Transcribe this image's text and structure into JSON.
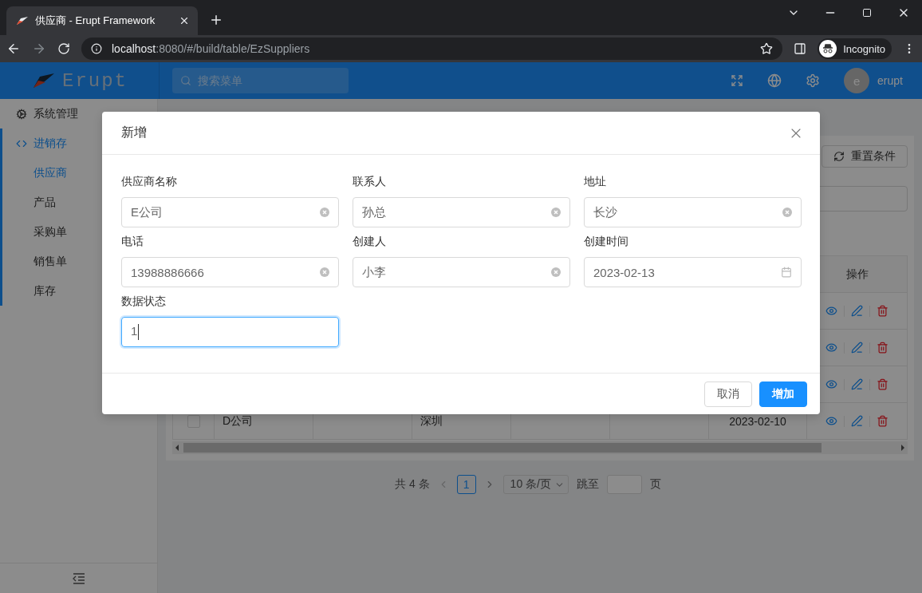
{
  "browser": {
    "tab_title": "供应商 - Erupt Framework",
    "url_host": "localhost",
    "url_path": ":8080/#/build/table/EzSuppliers",
    "profile": "Incognito"
  },
  "header": {
    "brand": "Erupt",
    "search_placeholder": "搜索菜单",
    "user_initial": "e",
    "user_name": "erupt"
  },
  "sidebar": {
    "items": [
      {
        "label": "系统管理",
        "kind": "cogs",
        "selected": false
      },
      {
        "label": "进销存",
        "kind": "code",
        "selected": true,
        "children": [
          {
            "label": "供应商",
            "selected": true
          },
          {
            "label": "产品",
            "selected": false
          },
          {
            "label": "采购单",
            "selected": false
          },
          {
            "label": "销售单",
            "selected": false
          },
          {
            "label": "库存",
            "selected": false
          }
        ]
      }
    ]
  },
  "toolbar": {
    "reset_button": "重置条件"
  },
  "table": {
    "action_header": "操作",
    "rows": [
      {
        "actions": [
          {
            "kind": "view"
          },
          {
            "kind": "edit"
          },
          {
            "kind": "delete"
          }
        ]
      },
      {
        "actions": [
          {
            "kind": "view"
          },
          {
            "kind": "edit"
          },
          {
            "kind": "delete"
          }
        ]
      },
      {
        "actions": [
          {
            "kind": "view"
          },
          {
            "kind": "edit"
          },
          {
            "kind": "delete"
          }
        ]
      },
      {
        "checked": false,
        "column_2": "D公司",
        "column_4": "深圳",
        "column_7": "2023-02-10",
        "actions": [
          {
            "kind": "view"
          },
          {
            "kind": "edit"
          },
          {
            "kind": "delete"
          }
        ]
      }
    ]
  },
  "pagination": {
    "total": "共 4 条",
    "pages": [
      {
        "label": "1",
        "selected": true
      }
    ],
    "page_size": "10 条/页",
    "jump_label": "跳至",
    "page_suffix": "页"
  },
  "modal": {
    "title": "新增",
    "fields": [
      {
        "label": "供应商名称",
        "value": "E公司",
        "kind": "text",
        "clearable": true,
        "focused": false
      },
      {
        "label": "联系人",
        "value": "孙总",
        "kind": "text",
        "clearable": true,
        "focused": false
      },
      {
        "label": "地址",
        "value": "长沙",
        "kind": "text",
        "clearable": true,
        "focused": false
      },
      {
        "label": "电话",
        "value": "13988886666",
        "kind": "text",
        "clearable": true,
        "focused": false
      },
      {
        "label": "创建人",
        "value": "小李",
        "kind": "text",
        "clearable": true,
        "focused": false
      },
      {
        "label": "创建时间",
        "value": "2023-02-13",
        "kind": "date",
        "clearable": false,
        "focused": false
      },
      {
        "label": "数据状态",
        "value": "1",
        "kind": "text",
        "clearable": false,
        "focused": true
      }
    ],
    "buttons": [
      {
        "label": "取消",
        "kind": "default"
      },
      {
        "label": "增加",
        "kind": "primary"
      }
    ]
  }
}
